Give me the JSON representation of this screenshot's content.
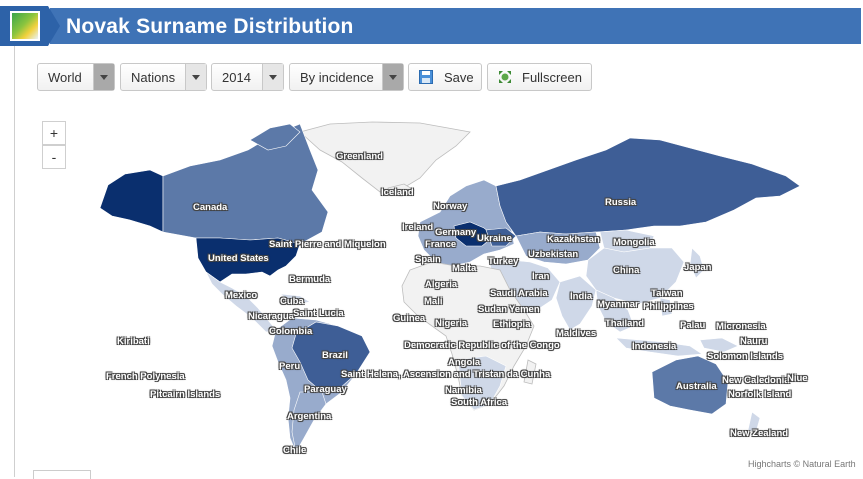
{
  "header": {
    "title": "Novak Surname Distribution"
  },
  "toolbar": {
    "region": "World",
    "level": "Nations",
    "year": "2014",
    "metric": "By incidence",
    "save": "Save",
    "fullscreen": "Fullscreen"
  },
  "zoom": {
    "in": "+",
    "out": "-"
  },
  "credit": "Highcharts © Natural Earth",
  "colors": {
    "header": "#3f73b6",
    "dark": "#0a2f6e",
    "mid": "#3e5e96",
    "light": "#98abcc",
    "pale": "#cfd8e8",
    "none": "#f2f2f2"
  },
  "map_labels": [
    "Greenland",
    "Iceland",
    "Canada",
    "Norway",
    "Ireland",
    "Germany",
    "Ukraine",
    "Russia",
    "Kazakhstan",
    "Mongolia",
    "France",
    "Spain",
    "Malta",
    "Uzbekistan",
    "Turkey",
    "United States",
    "Saint Pierre and Miquelon",
    "Bermuda",
    "Mexico",
    "Cuba",
    "Nicaragua",
    "Saint Lucia",
    "Colombia",
    "Algeria",
    "Iran",
    "China",
    "Japan",
    "Mali",
    "Saudi Arabia",
    "India",
    "Taiwan",
    "Myanmar",
    "Philippines",
    "Guinea",
    "Nigeria",
    "Sudan",
    "Yemen",
    "Ethiopia",
    "Thailand",
    "Palau",
    "Micronesia",
    "Maldives",
    "Kiribati",
    "Democratic Republic of the Congo",
    "Indonesia",
    "Nauru",
    "Brazil",
    "Peru",
    "Angola",
    "Solomon Islands",
    "French Polynesia",
    "Saint Helena, Ascension and Tristan da Cunha",
    "New Caledonia",
    "Niue",
    "Australia",
    "Paraguay",
    "Namibia",
    "Pitcairn Islands",
    "Norfolk Island",
    "South Africa",
    "Argentina",
    "New Zealand",
    "Chile"
  ]
}
